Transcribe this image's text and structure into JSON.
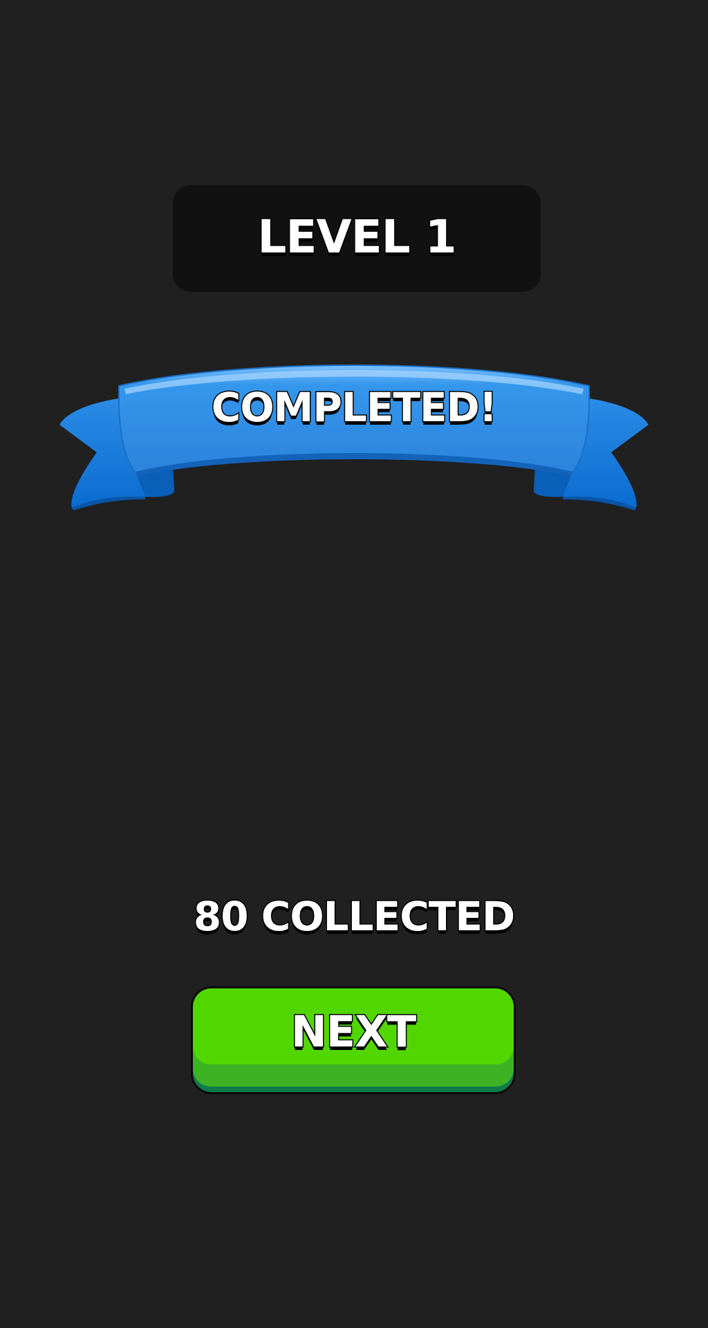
{
  "level": {
    "title": "LEVEL 1"
  },
  "banner": {
    "text": "COMPLETED!",
    "color": "#2f8fe6"
  },
  "collected": {
    "text": "80 COLLECTED"
  },
  "next_button": {
    "label": "NEXT",
    "color": "#52d600"
  },
  "colors": {
    "background": "#202020",
    "panel": "#111111",
    "text": "#ffffff",
    "outline": "#000000"
  }
}
